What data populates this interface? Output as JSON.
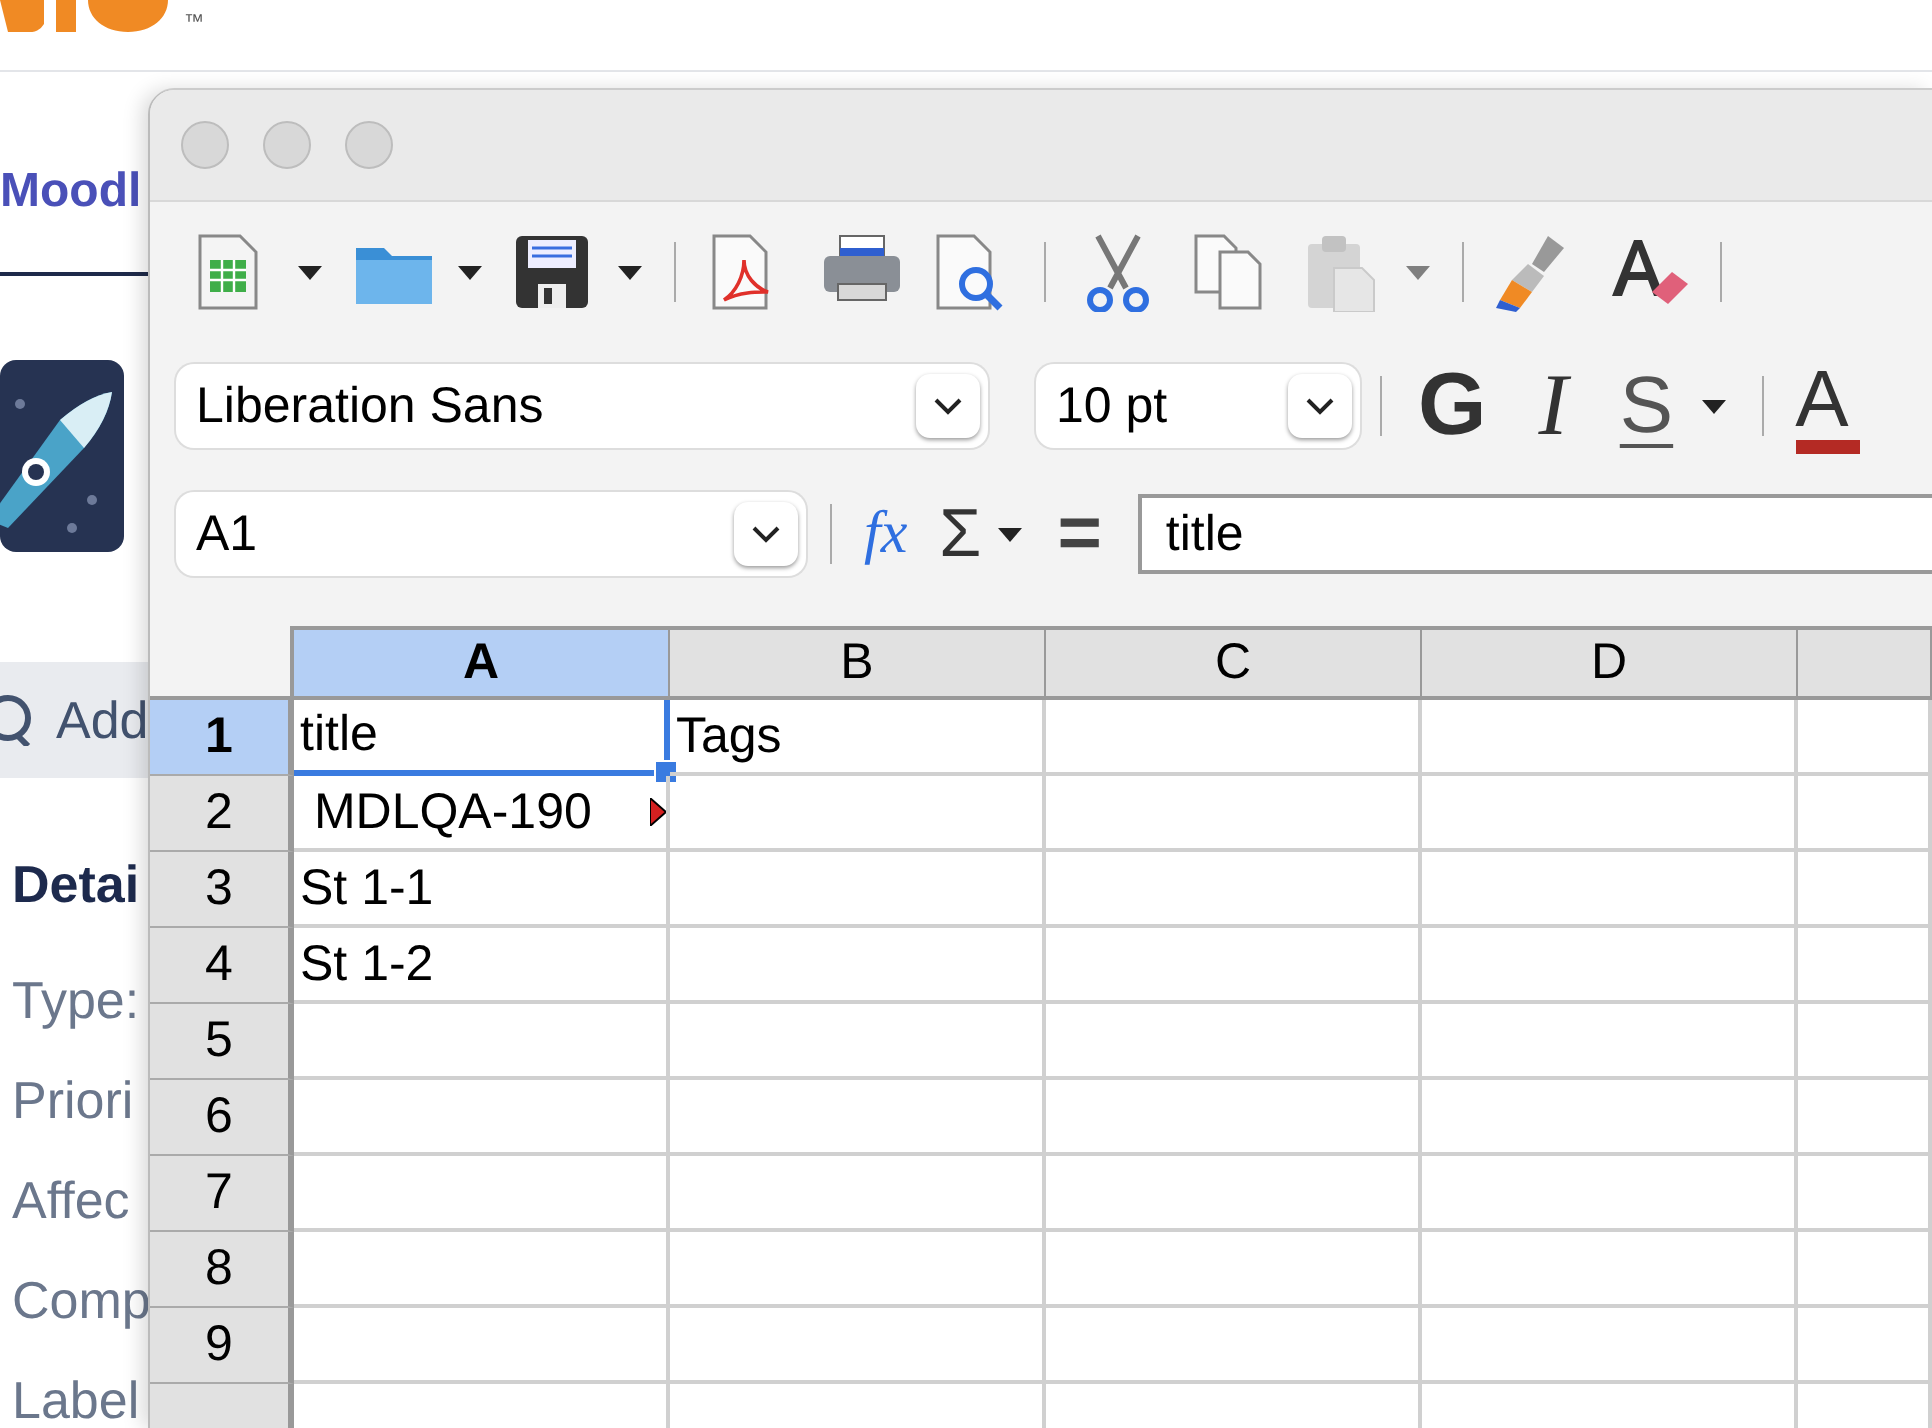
{
  "background_page": {
    "logo_trademark": "™",
    "project_link": "Moodl",
    "add_button": "Add",
    "section_heading": "Detai",
    "field_labels": [
      "Type:",
      "Priori",
      "Affec",
      "Comp",
      "Label"
    ]
  },
  "toolbar": [
    {
      "kind": "new",
      "dropdown": true,
      "disabled": false
    },
    {
      "kind": "open",
      "dropdown": true,
      "disabled": false
    },
    {
      "kind": "save",
      "dropdown": true,
      "disabled": false
    },
    {
      "kind": "separator"
    },
    {
      "kind": "pdf",
      "dropdown": false,
      "disabled": false
    },
    {
      "kind": "print",
      "dropdown": false,
      "disabled": false
    },
    {
      "kind": "preview",
      "dropdown": false,
      "disabled": false
    },
    {
      "kind": "separator"
    },
    {
      "kind": "cut",
      "dropdown": false,
      "disabled": false
    },
    {
      "kind": "copy",
      "dropdown": false,
      "disabled": false
    },
    {
      "kind": "paste",
      "dropdown": true,
      "disabled": true
    },
    {
      "kind": "separator"
    },
    {
      "kind": "clone",
      "dropdown": false,
      "disabled": false
    },
    {
      "kind": "clear",
      "dropdown": false,
      "disabled": false
    },
    {
      "kind": "separator"
    }
  ],
  "formatting": {
    "font_name": "Liberation Sans",
    "font_size": "10 pt",
    "bold": "G",
    "italic": "I",
    "underline": "S",
    "font_color": "A"
  },
  "formula_bar": {
    "name_box": "A1",
    "function_wizard": "fx",
    "sum": "Σ",
    "equals": "=",
    "input": "title"
  },
  "sheet": {
    "columns": [
      {
        "label": "A",
        "selected": true
      },
      {
        "label": "B",
        "selected": false
      },
      {
        "label": "C",
        "selected": false
      },
      {
        "label": "D",
        "selected": false
      }
    ],
    "rows": [
      {
        "label": "1",
        "selected": true,
        "cells": [
          {
            "text": "title",
            "selected": true,
            "overflow": false
          },
          {
            "text": "Tags",
            "selected": false,
            "overflow": false
          }
        ]
      },
      {
        "label": "2",
        "selected": false,
        "cells": [
          {
            "text": " MDLQA-190",
            "selected": false,
            "overflow": true
          }
        ]
      },
      {
        "label": "3",
        "selected": false,
        "cells": [
          {
            "text": "St 1-1",
            "selected": false,
            "overflow": false
          }
        ]
      },
      {
        "label": "4",
        "selected": false,
        "cells": [
          {
            "text": "St 1-2",
            "selected": false,
            "overflow": false
          }
        ]
      },
      {
        "label": "5",
        "selected": false,
        "cells": []
      },
      {
        "label": "6",
        "selected": false,
        "cells": []
      },
      {
        "label": "7",
        "selected": false,
        "cells": []
      },
      {
        "label": "8",
        "selected": false,
        "cells": []
      },
      {
        "label": "9",
        "selected": false,
        "cells": []
      }
    ]
  }
}
